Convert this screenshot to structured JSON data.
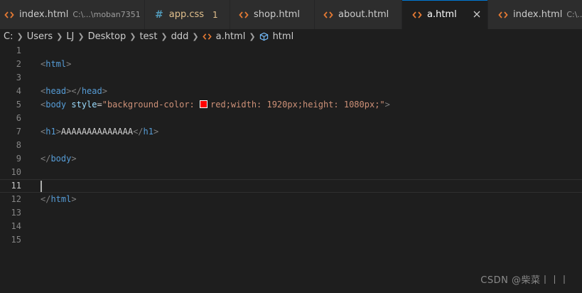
{
  "tabs": [
    {
      "label": "index.html",
      "description": "C:\\...\\moban7351",
      "icon": "html-code-icon"
    },
    {
      "label": "app.css",
      "badge": "1",
      "icon": "css-hash-icon",
      "modified": true
    },
    {
      "label": "shop.html",
      "icon": "html-code-icon"
    },
    {
      "label": "about.html",
      "icon": "html-code-icon"
    },
    {
      "label": "a.html",
      "icon": "html-code-icon",
      "active": true
    },
    {
      "label": "index.html",
      "description": "C:\\...\\d",
      "icon": "html-code-icon"
    }
  ],
  "breadcrumb": {
    "items": [
      "C:",
      "Users",
      "LJ",
      "Desktop",
      "test",
      "ddd",
      "a.html",
      "html"
    ]
  },
  "editor": {
    "current_line": 11,
    "line_numbers": [
      "1",
      "2",
      "3",
      "4",
      "5",
      "6",
      "7",
      "8",
      "9",
      "10",
      "11",
      "12",
      "13",
      "14",
      "15"
    ],
    "lines": {
      "l2": {
        "open": "<",
        "name": "html",
        "close": ">"
      },
      "l4": {
        "open1": "<",
        "name1": "head",
        "close1": ">",
        "open2": "</",
        "name2": "head",
        "close2": ">"
      },
      "l5": {
        "open": "<",
        "name": "body",
        "space": " ",
        "attr": "style",
        "eq": "=",
        "val_start": "\"background-color: ",
        "val_end": "red;width: 1920px;height: 1080px;\"",
        "close": ">",
        "swatch_color": "#ff0000"
      },
      "l7": {
        "open1": "<",
        "name1": "h1",
        "close1": ">",
        "text": "AAAAAAAAAAAAAA",
        "open2": "</",
        "name2": "h1",
        "close2": ">"
      },
      "l9": {
        "open": "</",
        "name": "body",
        "close": ">"
      },
      "l12": {
        "open": "</",
        "name": "html",
        "close": ">"
      }
    }
  },
  "watermark": "CSDN @柴菜丨丨丨",
  "colors": {
    "accent": "#0078d4",
    "html_icon": "#e37933",
    "css_icon": "#519aba",
    "tag": "#569cd6",
    "attribute": "#9cdcfe",
    "string": "#ce9178"
  }
}
